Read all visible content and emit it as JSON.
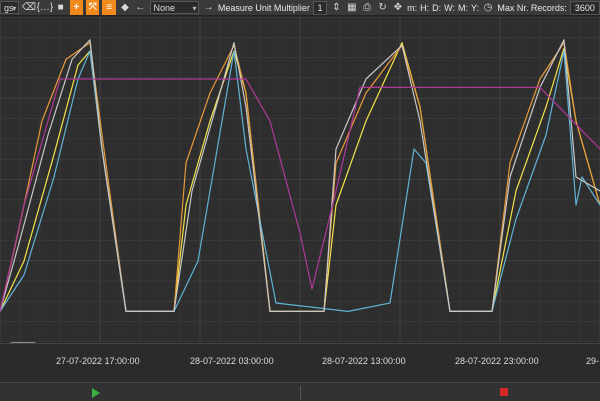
{
  "toolbar": {
    "partial_select": "gs",
    "zoom_in_icon": "plus-icon",
    "mode_value": "None",
    "measure_unit_label": "Measure Unit Multiplier",
    "measure_unit_value": "1",
    "interval_labels": [
      "m:",
      "H:",
      "D:",
      "W:",
      "M:",
      "Y:"
    ],
    "max_records_label": "Max Nr. Records:",
    "max_records_value": "3600"
  },
  "xaxis": {
    "ticks": [
      "27-07-2022 17:00:00",
      "28-07-2022 03:00:00",
      "28-07-2022 13:00:00",
      "28-07-2022 23:00:00",
      "29-"
    ]
  },
  "colors": {
    "background": "#2e2e2e",
    "grid": "#474747",
    "accent": "#f08a1c",
    "play": "#3cb043",
    "stop": "#d42a2a"
  },
  "chart_data": {
    "type": "line",
    "title": "",
    "xlabel": "",
    "ylabel": "",
    "grid": true,
    "x_range": [
      0,
      100
    ],
    "ylim": [
      0,
      100
    ],
    "series": [
      {
        "color": "#f5e34a",
        "points": [
          [
            0,
            2
          ],
          [
            4,
            20
          ],
          [
            9,
            58
          ],
          [
            13,
            90
          ],
          [
            15,
            95
          ],
          [
            17,
            60
          ],
          [
            21,
            2
          ],
          [
            29,
            2
          ],
          [
            31,
            40
          ],
          [
            35,
            70
          ],
          [
            39,
            95
          ],
          [
            41,
            80
          ],
          [
            45,
            2
          ],
          [
            54,
            2
          ],
          [
            56,
            40
          ],
          [
            61,
            70
          ],
          [
            67,
            98
          ],
          [
            70,
            75
          ],
          [
            75,
            2
          ],
          [
            82,
            2
          ],
          [
            86,
            45
          ],
          [
            91,
            75
          ],
          [
            94,
            96
          ],
          [
            96,
            70
          ],
          [
            100,
            40
          ]
        ]
      },
      {
        "color": "#e89a3a",
        "points": [
          [
            0,
            2
          ],
          [
            3,
            30
          ],
          [
            7,
            70
          ],
          [
            11,
            92
          ],
          [
            15,
            98
          ],
          [
            17,
            65
          ],
          [
            21,
            2
          ],
          [
            29,
            2
          ],
          [
            31,
            55
          ],
          [
            35,
            80
          ],
          [
            39,
            97
          ],
          [
            41,
            80
          ],
          [
            45,
            2
          ],
          [
            54,
            2
          ],
          [
            56,
            55
          ],
          [
            61,
            80
          ],
          [
            67,
            97
          ],
          [
            70,
            75
          ],
          [
            75,
            2
          ],
          [
            82,
            2
          ],
          [
            85,
            55
          ],
          [
            90,
            85
          ],
          [
            94,
            98
          ],
          [
            96,
            70
          ],
          [
            100,
            40
          ]
        ]
      },
      {
        "color": "#5fb3d6",
        "points": [
          [
            0,
            2
          ],
          [
            4,
            15
          ],
          [
            9,
            50
          ],
          [
            13,
            85
          ],
          [
            15,
            95
          ],
          [
            17,
            60
          ],
          [
            21,
            2
          ],
          [
            29,
            2
          ],
          [
            33,
            20
          ],
          [
            37,
            70
          ],
          [
            39,
            95
          ],
          [
            41,
            60
          ],
          [
            46,
            5
          ],
          [
            58,
            2
          ],
          [
            65,
            5
          ],
          [
            69,
            60
          ],
          [
            71,
            55
          ],
          [
            75,
            2
          ],
          [
            82,
            2
          ],
          [
            86,
            35
          ],
          [
            91,
            65
          ],
          [
            94,
            95
          ],
          [
            96,
            40
          ],
          [
            97,
            50
          ],
          [
            100,
            40
          ]
        ]
      },
      {
        "color": "#c8c8c8",
        "points": [
          [
            0,
            2
          ],
          [
            3,
            25
          ],
          [
            8,
            65
          ],
          [
            12,
            92
          ],
          [
            15,
            99
          ],
          [
            17,
            60
          ],
          [
            21,
            2
          ],
          [
            29,
            2
          ],
          [
            32,
            45
          ],
          [
            36,
            75
          ],
          [
            39,
            98
          ],
          [
            41,
            75
          ],
          [
            45,
            2
          ],
          [
            54,
            2
          ],
          [
            56,
            60
          ],
          [
            61,
            85
          ],
          [
            67,
            97
          ],
          [
            70,
            70
          ],
          [
            75,
            2
          ],
          [
            82,
            2
          ],
          [
            85,
            50
          ],
          [
            90,
            82
          ],
          [
            94,
            99
          ],
          [
            96,
            50
          ],
          [
            100,
            45
          ]
        ]
      },
      {
        "color": "#b0399a",
        "points": [
          [
            0,
            2
          ],
          [
            4,
            40
          ],
          [
            10,
            85
          ],
          [
            15,
            85
          ],
          [
            25,
            85
          ],
          [
            35,
            85
          ],
          [
            41,
            85
          ],
          [
            45,
            70
          ],
          [
            50,
            30
          ],
          [
            52,
            10
          ],
          [
            56,
            45
          ],
          [
            60,
            82
          ],
          [
            70,
            82
          ],
          [
            80,
            82
          ],
          [
            90,
            82
          ],
          [
            100,
            60
          ]
        ]
      }
    ]
  }
}
